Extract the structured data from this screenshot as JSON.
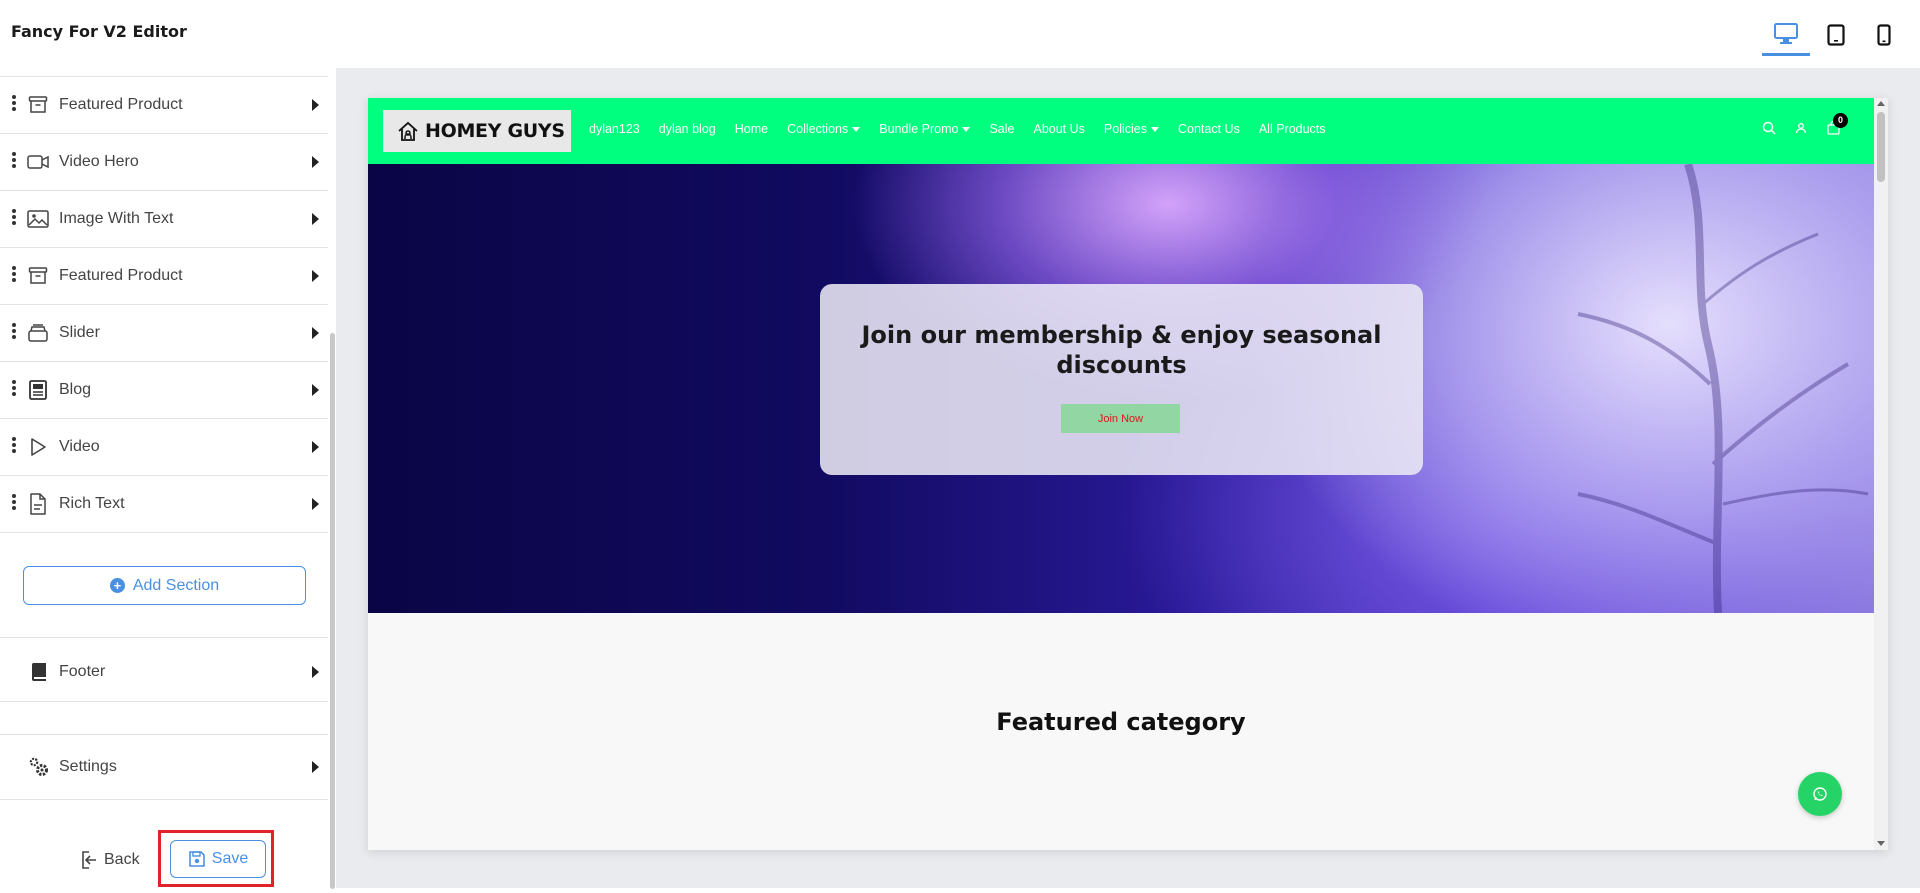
{
  "app": {
    "title": "Fancy For V2 Editor"
  },
  "devices": [
    {
      "name": "desktop",
      "icon": "desktop-icon",
      "active": true
    },
    {
      "name": "tablet",
      "icon": "tablet-icon",
      "active": false
    },
    {
      "name": "mobile",
      "icon": "mobile-icon",
      "active": false
    }
  ],
  "sidebar": {
    "sections": [
      {
        "label": "Featured Product",
        "icon": "archive-box-icon"
      },
      {
        "label": "Video Hero",
        "icon": "video-camera-icon"
      },
      {
        "label": "Image With Text",
        "icon": "image-icon"
      },
      {
        "label": "Featured Product",
        "icon": "archive-box-icon"
      },
      {
        "label": "Slider",
        "icon": "layers-icon"
      },
      {
        "label": "Blog",
        "icon": "newspaper-icon"
      },
      {
        "label": "Video",
        "icon": "play-icon"
      },
      {
        "label": "Rich Text",
        "icon": "document-text-icon"
      }
    ],
    "add_section_label": "Add Section",
    "footer_label": "Footer",
    "settings_label": "Settings",
    "back_label": "Back",
    "save_label": "Save"
  },
  "preview": {
    "logo_text": "HOMEY GUYS",
    "nav_links": [
      {
        "label": "dylan123",
        "dropdown": false
      },
      {
        "label": "dylan blog",
        "dropdown": false
      },
      {
        "label": "Home",
        "dropdown": false
      },
      {
        "label": "Collections",
        "dropdown": true
      },
      {
        "label": "Bundle Promo",
        "dropdown": true
      },
      {
        "label": "Sale",
        "dropdown": false
      },
      {
        "label": "About Us",
        "dropdown": false
      },
      {
        "label": "Policies",
        "dropdown": true
      },
      {
        "label": "Contact Us",
        "dropdown": false
      },
      {
        "label": "All Products",
        "dropdown": false
      }
    ],
    "cart_count": "0",
    "hero_heading": "Join our membership & enjoy seasonal discounts",
    "hero_button": "Join Now",
    "featured_heading": "Featured category"
  },
  "colors": {
    "accent": "#4a90e2",
    "nav_bg": "#00ff7f",
    "highlight": "#e0232b",
    "join_button_bg": "#92d7a3",
    "join_button_text": "#e0151b",
    "whatsapp": "#25d366"
  }
}
